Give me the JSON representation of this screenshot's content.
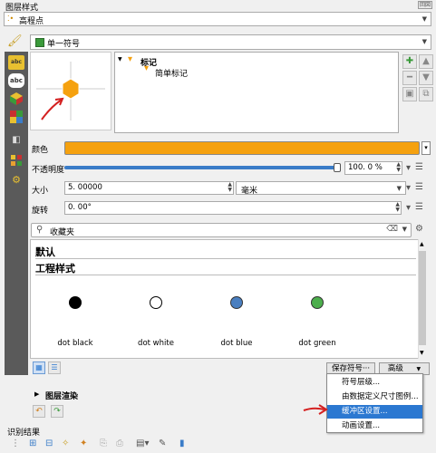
{
  "window": {
    "title": "图层样式",
    "title_buttons": "回図"
  },
  "layer": {
    "name": "高程点"
  },
  "renderer": {
    "label": "单一符号"
  },
  "symbol_tree": {
    "root": "标记",
    "child": "简单标记"
  },
  "colors": {
    "fill": "#f5a10f",
    "accent": "#2b78d1",
    "sidebar": "#5a5a5a"
  },
  "props": {
    "color_label": "颜色",
    "opacity_label": "不透明度",
    "opacity_value": "100. 0 %",
    "opacity_fraction": 1.0,
    "size_label": "大小",
    "size_value": "5. 00000",
    "unit_value": "毫米",
    "rotation_label": "旋转",
    "rotation_value": "0. 00°"
  },
  "search": {
    "placeholder": "收藏夹"
  },
  "gallery": {
    "section1": "默认",
    "section2": "工程样式",
    "items": [
      {
        "label": "dot  black",
        "color": "#000000"
      },
      {
        "label": "dot  white",
        "color": "#ffffff"
      },
      {
        "label": "dot blue",
        "color": "#4a7fc0"
      },
      {
        "label": "dot green",
        "color": "#4cae4c"
      }
    ]
  },
  "buttons": {
    "save_symbol": "保存符号···",
    "advanced": "高级"
  },
  "advanced_menu": [
    {
      "label": "符号层级..."
    },
    {
      "label": "由数据定义尺寸图例..."
    },
    {
      "label": "缓冲区设置..."
    },
    {
      "label": "动画设置..."
    }
  ],
  "layer_render": {
    "label": "图层渲染"
  },
  "status": {
    "text": "识别结果"
  }
}
